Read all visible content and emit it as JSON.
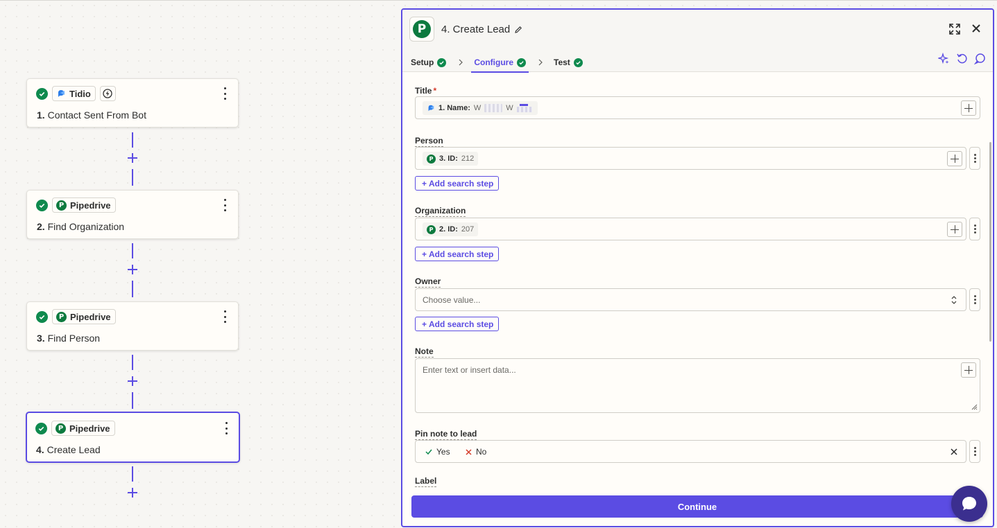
{
  "canvas": {
    "steps": [
      {
        "app": "Tidio",
        "number": "1.",
        "title": "Contact Sent From Bot",
        "has_trigger": true
      },
      {
        "app": "Pipedrive",
        "number": "2.",
        "title": "Find Organization",
        "has_trigger": false
      },
      {
        "app": "Pipedrive",
        "number": "3.",
        "title": "Find Person",
        "has_trigger": false
      },
      {
        "app": "Pipedrive",
        "number": "4.",
        "title": "Create Lead",
        "has_trigger": false,
        "selected": true
      }
    ]
  },
  "panel": {
    "title": "4. Create Lead",
    "logo_letter": "P",
    "tabs": [
      {
        "label": "Setup",
        "done": true
      },
      {
        "label": "Configure",
        "done": true,
        "active": true
      },
      {
        "label": "Test",
        "done": true
      }
    ],
    "fields": {
      "title": {
        "label": "Title",
        "required_mark": "*",
        "chip_label": "1. Name:",
        "chip_value": "W"
      },
      "person": {
        "label": "Person",
        "chip_label": "3. ID:",
        "chip_value": "212",
        "search_btn": "Add search step"
      },
      "organization": {
        "label": "Organization",
        "chip_label": "2. ID:",
        "chip_value": "207",
        "search_btn": "Add search step"
      },
      "owner": {
        "label": "Owner",
        "placeholder": "Choose value...",
        "search_btn": "Add search step"
      },
      "note": {
        "label": "Note",
        "placeholder": "Enter text or insert data..."
      },
      "pin_note": {
        "label": "Pin note to lead",
        "yes": "Yes",
        "no": "No"
      },
      "label": {
        "label": "Label"
      }
    },
    "continue_label": "Continue"
  },
  "colors": {
    "accent": "#5b4ce3",
    "success": "#0f8a4e",
    "pipedrive": "#0d7a3f"
  }
}
